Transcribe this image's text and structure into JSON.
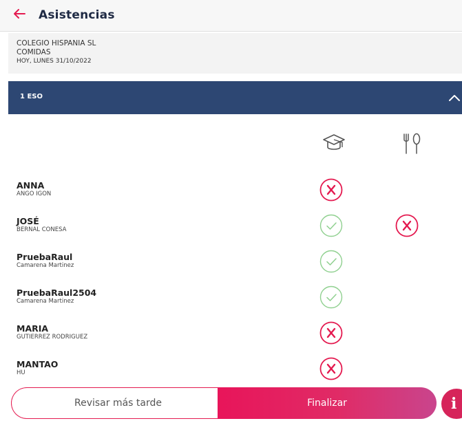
{
  "header": {
    "title": "Asistencias"
  },
  "info": {
    "school": "COLEGIO HISPANIA SL",
    "service": "COMIDAS",
    "date": "HOY, LUNES 31/10/2022"
  },
  "group": {
    "name": "1 ESO"
  },
  "columns": [
    {
      "icon": "graduation-cap-icon"
    },
    {
      "icon": "fork-spoon-icon"
    }
  ],
  "students": [
    {
      "name": "ANNA",
      "surname": "ANGO IGON",
      "class": "absent",
      "food": "none"
    },
    {
      "name": "JOSÉ",
      "surname": "BERNAL CONESA",
      "class": "present",
      "food": "absent"
    },
    {
      "name": "PruebaRaul",
      "surname": "Camarena Martinez",
      "class": "present",
      "food": "none"
    },
    {
      "name": "PruebaRaul2504",
      "surname": "Camarena Martinez",
      "class": "present",
      "food": "none"
    },
    {
      "name": "MARIA",
      "surname": "GUTIERREZ RODRIGUEZ",
      "class": "absent",
      "food": "none"
    },
    {
      "name": "MANTAO",
      "surname": "HU",
      "class": "absent",
      "food": "none"
    }
  ],
  "actions": {
    "later_label": "Revisar más tarde",
    "finish_label": "Finalizar",
    "info_label": "i"
  },
  "colors": {
    "accent": "#e4194f",
    "header_bar": "#2d4773",
    "present": "#8fd08f"
  }
}
